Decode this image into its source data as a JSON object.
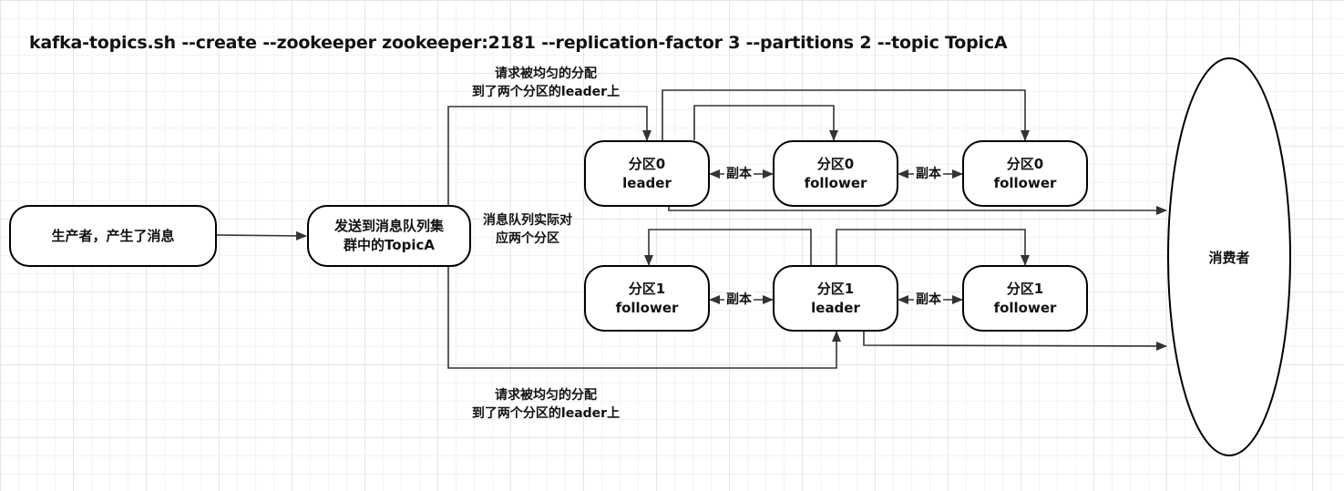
{
  "title": "kafka-topics.sh --create --zookeeper zookeeper:2181 --replication-factor 3 --partitions 2 --topic TopicA",
  "producer": {
    "label": "生产者，产生了消息"
  },
  "topic": {
    "line1": "发送到消息队列集",
    "line2": "群中的TopicA"
  },
  "topic_note": {
    "line1": "消息队列实际对",
    "line2": "应两个分区"
  },
  "request_note_top": {
    "line1": "请求被均匀的分配",
    "line2": "到了两个分区的leader上"
  },
  "request_note_bottom": {
    "line1": "请求被均匀的分配",
    "line2": "到了两个分区的leader上"
  },
  "replica_label": "副本",
  "consumer": {
    "label": "消费者"
  },
  "partitions": [
    {
      "name": "分区0",
      "replicas": [
        {
          "name": "分区0",
          "role": "leader"
        },
        {
          "name": "分区0",
          "role": "follower"
        },
        {
          "name": "分区0",
          "role": "follower"
        }
      ]
    },
    {
      "name": "分区1",
      "replicas": [
        {
          "name": "分区1",
          "role": "follower"
        },
        {
          "name": "分区1",
          "role": "leader"
        },
        {
          "name": "分区1",
          "role": "follower"
        }
      ]
    }
  ],
  "colors": {
    "line": "#333333",
    "border": "#000000",
    "grid": "#e6e6e6"
  }
}
